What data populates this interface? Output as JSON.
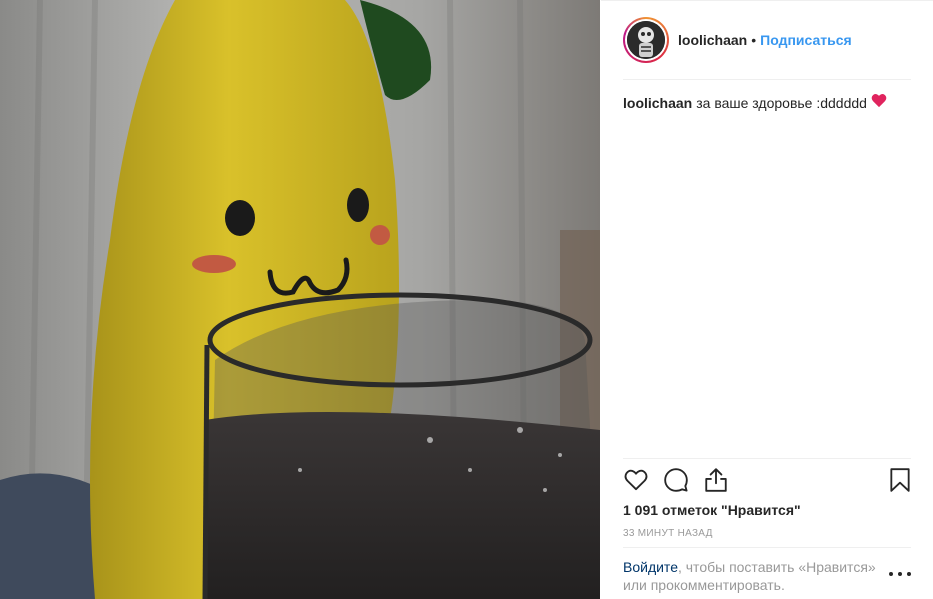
{
  "post": {
    "image_alt": "",
    "username": "loolichaan",
    "separator": "•",
    "follow_label": "Подписаться",
    "caption": {
      "username": "loolichaan",
      "text": "за ваше здоровье :dddddd",
      "emoji": "heart"
    },
    "likes_text": "1 091 отметок \"Нравится\"",
    "timestamp": "33 минут назад",
    "login_prompt": {
      "link": "Войдите",
      "text": ", чтобы поставить «Нравится» или прокомментировать."
    }
  },
  "icons": {
    "like": "heart-outline-icon",
    "comment": "comment-bubble-icon",
    "share": "share-upload-icon",
    "save": "bookmark-icon",
    "more": "more-options-icon"
  },
  "colors": {
    "link_blue": "#3897f0",
    "login_link": "#003569",
    "muted": "#999999",
    "text": "#262626",
    "heart_red": "#e0245e"
  }
}
